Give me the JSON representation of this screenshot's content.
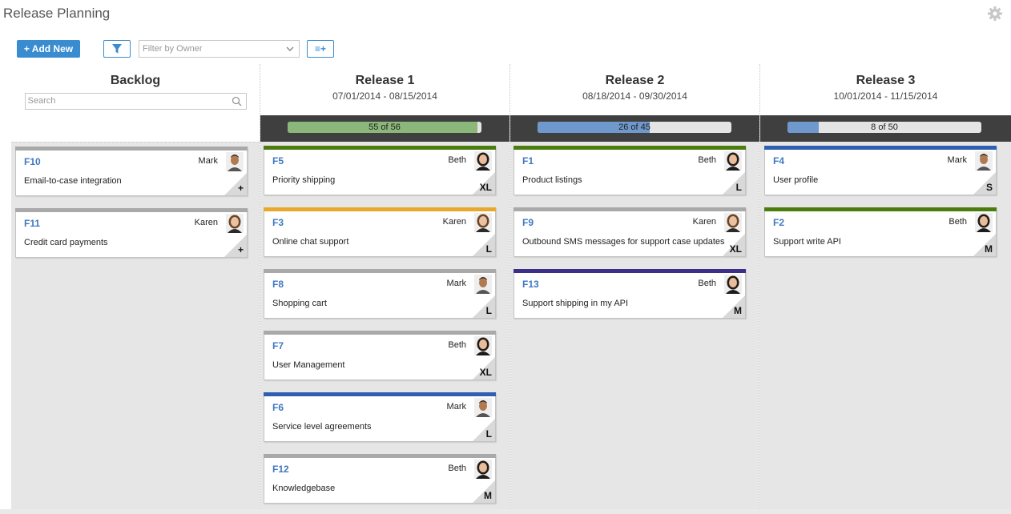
{
  "app": {
    "title": "Release Planning"
  },
  "toolbar": {
    "add_label": "+ Add New",
    "owner_placeholder": "Filter by Owner",
    "list_label": "≡+"
  },
  "backlog": {
    "name": "Backlog",
    "search_placeholder": "Search",
    "cards": [
      {
        "id": "F10",
        "owner": "Mark",
        "title": "Email-to-case integration",
        "size": "+",
        "stripe": "#a9a9a9",
        "avatar": "mark"
      },
      {
        "id": "F11",
        "owner": "Karen",
        "title": "Credit card payments",
        "size": "+",
        "stripe": "#a9a9a9",
        "avatar": "karen"
      }
    ]
  },
  "releases": [
    {
      "name": "Release 1",
      "dates": "07/01/2014 - 08/15/2014",
      "progress_label": "55 of 56",
      "progress_fraction": 0.98,
      "progress_color": "#8bb77a",
      "cards": [
        {
          "id": "F5",
          "owner": "Beth",
          "title": "Priority shipping",
          "size": "XL",
          "stripe": "#4a7d0e",
          "avatar": "beth"
        },
        {
          "id": "F3",
          "owner": "Karen",
          "title": "Online chat support",
          "size": "L",
          "stripe": "#e8a82e",
          "avatar": "karen"
        },
        {
          "id": "F8",
          "owner": "Mark",
          "title": "Shopping cart",
          "size": "L",
          "stripe": "#a9a9a9",
          "avatar": "mark"
        },
        {
          "id": "F7",
          "owner": "Beth",
          "title": "User Management",
          "size": "XL",
          "stripe": "#a9a9a9",
          "avatar": "beth"
        },
        {
          "id": "F6",
          "owner": "Mark",
          "title": "Service level agreements",
          "size": "L",
          "stripe": "#2f5fb0",
          "avatar": "mark"
        },
        {
          "id": "F12",
          "owner": "Beth",
          "title": "Knowledgebase",
          "size": "M",
          "stripe": "#a9a9a9",
          "avatar": "beth"
        }
      ]
    },
    {
      "name": "Release 2",
      "dates": "08/18/2014 - 09/30/2014",
      "progress_label": "26 of 45",
      "progress_fraction": 0.58,
      "progress_color": "#6f98cc",
      "cards": [
        {
          "id": "F1",
          "owner": "Beth",
          "title": "Product listings",
          "size": "L",
          "stripe": "#4a7d0e",
          "avatar": "beth"
        },
        {
          "id": "F9",
          "owner": "Karen",
          "title": "Outbound SMS messages for support case updates",
          "size": "XL",
          "stripe": "#a9a9a9",
          "avatar": "karen"
        },
        {
          "id": "F13",
          "owner": "Beth",
          "title": "Support shipping in my API",
          "size": "M",
          "stripe": "#3b2f87",
          "avatar": "beth"
        }
      ]
    },
    {
      "name": "Release 3",
      "dates": "10/01/2014 - 11/15/2014",
      "progress_label": "8 of 50",
      "progress_fraction": 0.16,
      "progress_color": "#6f98cc",
      "cards": [
        {
          "id": "F4",
          "owner": "Mark",
          "title": "User profile",
          "size": "S",
          "stripe": "#2f5fb0",
          "avatar": "mark"
        },
        {
          "id": "F2",
          "owner": "Beth",
          "title": "Support write API",
          "size": "M",
          "stripe": "#4a7d0e",
          "avatar": "beth"
        }
      ]
    }
  ]
}
